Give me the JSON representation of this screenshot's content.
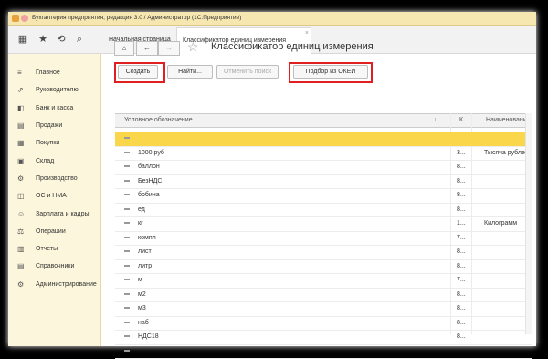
{
  "window_title": "Бухгалтерия предприятия, редакция 3.0 / Администратор  (1С:Предприятие)",
  "toolbar": {
    "home_tab": "Начальная страница",
    "active_tab": "Классификатор единиц измерения"
  },
  "sidebar": {
    "items": [
      {
        "label": "Главное",
        "icon": "≡"
      },
      {
        "label": "Руководителю",
        "icon": "⇗"
      },
      {
        "label": "Банк и касса",
        "icon": "◧"
      },
      {
        "label": "Продажи",
        "icon": "▤"
      },
      {
        "label": "Покупки",
        "icon": "▦"
      },
      {
        "label": "Склад",
        "icon": "▣"
      },
      {
        "label": "Производство",
        "icon": "⚙"
      },
      {
        "label": "ОС и НМА",
        "icon": "◫"
      },
      {
        "label": "Зарплата и кадры",
        "icon": "☺"
      },
      {
        "label": "Операции",
        "icon": "⚖"
      },
      {
        "label": "Отчеты",
        "icon": "▥"
      },
      {
        "label": "Справочники",
        "icon": "▤"
      },
      {
        "label": "Администрирование",
        "icon": "⚙"
      }
    ]
  },
  "header": {
    "title": "Классификатор единиц измерения"
  },
  "commands": {
    "create": "Создать",
    "find": "Найти...",
    "cancel_search": "Отменить поиск",
    "okei": "Подбор из ОКЕИ"
  },
  "grid": {
    "columns": {
      "designation": "Условное обозначение",
      "sort_arrow": "↓",
      "code": "К...",
      "name": "Наименование"
    },
    "rows": [
      {
        "d": "",
        "c": "",
        "n": ""
      },
      {
        "d": "1000 руб",
        "c": "3...",
        "n": "Тысяча рублей"
      },
      {
        "d": "баллон",
        "c": "8...",
        "n": ""
      },
      {
        "d": "БезНДС",
        "c": "8...",
        "n": ""
      },
      {
        "d": "бобина",
        "c": "8...",
        "n": ""
      },
      {
        "d": "ед",
        "c": "8...",
        "n": ""
      },
      {
        "d": "кг",
        "c": "1...",
        "n": "Килограмм"
      },
      {
        "d": "компл",
        "c": "7...",
        "n": ""
      },
      {
        "d": "лист",
        "c": "8...",
        "n": ""
      },
      {
        "d": "литр",
        "c": "8...",
        "n": ""
      },
      {
        "d": "м",
        "c": "7...",
        "n": ""
      },
      {
        "d": "м2",
        "c": "8...",
        "n": ""
      },
      {
        "d": "м3",
        "c": "8...",
        "n": ""
      },
      {
        "d": "наб",
        "c": "8...",
        "n": ""
      },
      {
        "d": "НДС18",
        "c": "8...",
        "n": ""
      },
      {
        "d": "",
        "c": "",
        "n": ""
      }
    ]
  },
  "colors": {
    "accent": "#f9d64a",
    "sidebar": "#fcf6dc",
    "highlight": "#e02020"
  }
}
